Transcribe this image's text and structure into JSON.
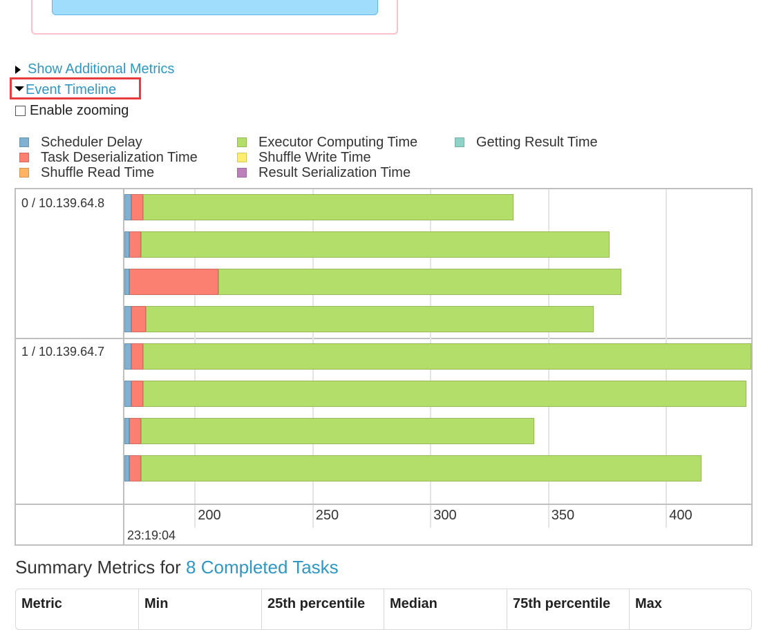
{
  "toggles": {
    "show_additional_metrics": "Show Additional Metrics",
    "event_timeline": "Event Timeline",
    "enable_zooming": "Enable zooming"
  },
  "legend": [
    {
      "label": "Scheduler Delay",
      "color": "#80b1d3",
      "border": "#6b94b0"
    },
    {
      "label": "Task Deserialization Time",
      "color": "#fb8072",
      "border": "#d26b5f"
    },
    {
      "label": "Shuffle Read Time",
      "color": "#fdb462",
      "border": "#d39651"
    },
    {
      "label": "Executor Computing Time",
      "color": "#b3de69",
      "border": "#95b957"
    },
    {
      "label": "Shuffle Write Time",
      "color": "#ffed6f",
      "border": "#d5c65c"
    },
    {
      "label": "Result Serialization Time",
      "color": "#bc80bd",
      "border": "#9d6b9e"
    },
    {
      "label": "Getting Result Time",
      "color": "#8dd3c7",
      "border": "#75b0a6"
    }
  ],
  "timeline": {
    "groups": [
      {
        "label": "0 / 10.139.64.8",
        "tasks": [
          {
            "start": 170,
            "delay": 3,
            "deser": 5,
            "compute": 157
          },
          {
            "start": 170,
            "delay": 2,
            "deser": 5,
            "compute": 199
          },
          {
            "start": 170,
            "delay": 2,
            "deser": 38,
            "compute": 171
          },
          {
            "start": 170,
            "delay": 3,
            "deser": 6,
            "compute": 190
          }
        ]
      },
      {
        "label": "1 / 10.139.64.7",
        "tasks": [
          {
            "start": 170,
            "delay": 3,
            "deser": 5,
            "compute": 258
          },
          {
            "start": 170,
            "delay": 3,
            "deser": 5,
            "compute": 256
          },
          {
            "start": 170,
            "delay": 2,
            "deser": 5,
            "compute": 167
          },
          {
            "start": 170,
            "delay": 2,
            "deser": 5,
            "compute": 238
          }
        ]
      }
    ],
    "axis": {
      "ticks": [
        200,
        250,
        300,
        350,
        400
      ],
      "date_label": "23:19:04",
      "range": [
        170,
        436
      ]
    }
  },
  "summary": {
    "title_prefix": "Summary Metrics for ",
    "title_link": "8 Completed Tasks",
    "columns": [
      "Metric",
      "Min",
      "25th percentile",
      "Median",
      "75th percentile",
      "Max"
    ]
  }
}
